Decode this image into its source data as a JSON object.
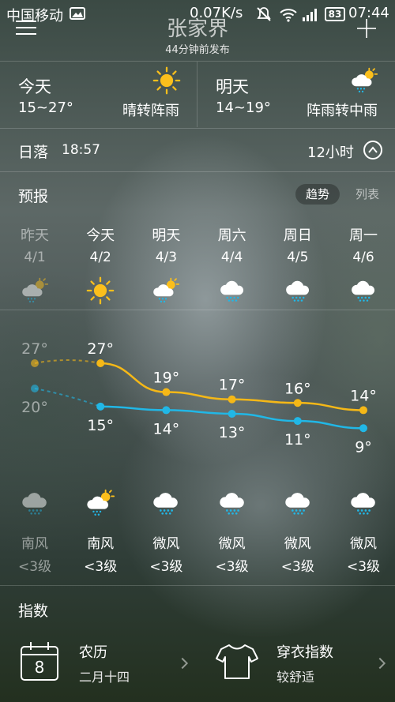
{
  "status_bar": {
    "carrier": "中国移动",
    "speed": "0.07K/s",
    "battery": "83",
    "time": "07:44"
  },
  "header": {
    "city": "张家界",
    "published": "44分钟前发布"
  },
  "today": {
    "label": "今天",
    "range": "15~27°",
    "condition": "晴转阵雨",
    "icon": "sun-icon"
  },
  "tomorrow": {
    "label": "明天",
    "range": "14~19°",
    "condition": "阵雨转中雨",
    "icon": "cloud-rain-sun-icon"
  },
  "sunset": {
    "label": "日落",
    "time": "18:57",
    "toggle_label": "12小时"
  },
  "forecast": {
    "title": "预报",
    "tab_trend": "趋势",
    "tab_list": "列表",
    "days": [
      {
        "name": "昨天",
        "date": "4/1",
        "day_icon": "cloud-sun-rain-icon",
        "high": 27,
        "low": 20,
        "night_icon": "cloud-rain-icon",
        "wind_dir": "南风",
        "wind_level": "<3级",
        "past": true
      },
      {
        "name": "今天",
        "date": "4/2",
        "day_icon": "sun-icon",
        "high": 27,
        "low": 15,
        "night_icon": "cloud-sun-rain-icon",
        "wind_dir": "南风",
        "wind_level": "<3级",
        "past": false
      },
      {
        "name": "明天",
        "date": "4/3",
        "day_icon": "cloud-sun-rain-icon",
        "high": 19,
        "low": 14,
        "night_icon": "cloud-rain-icon",
        "wind_dir": "微风",
        "wind_level": "<3级",
        "past": false
      },
      {
        "name": "周六",
        "date": "4/4",
        "day_icon": "cloud-rain-icon",
        "high": 17,
        "low": 13,
        "night_icon": "cloud-rain-icon",
        "wind_dir": "微风",
        "wind_level": "<3级",
        "past": false
      },
      {
        "name": "周日",
        "date": "4/5",
        "day_icon": "cloud-rain-icon",
        "high": 16,
        "low": 11,
        "night_icon": "cloud-rain-icon",
        "wind_dir": "微风",
        "wind_level": "<3级",
        "past": false
      },
      {
        "name": "周一",
        "date": "4/6",
        "day_icon": "cloud-rain-icon",
        "high": 14,
        "low": 9,
        "night_icon": "cloud-rain-icon",
        "wind_dir": "微风",
        "wind_level": "<3级",
        "past": false
      }
    ]
  },
  "chart_data": {
    "type": "line",
    "categories": [
      "4/1",
      "4/2",
      "4/3",
      "4/4",
      "4/5",
      "4/6"
    ],
    "series": [
      {
        "values": [
          27,
          27,
          19,
          17,
          16,
          14
        ],
        "color": "#f5b817"
      },
      {
        "values": [
          20,
          15,
          14,
          13,
          11,
          9
        ],
        "color": "#21b7e6"
      }
    ]
  },
  "indices": {
    "title": "指数",
    "items": [
      {
        "title": "农历",
        "value": "二月十四",
        "icon": "calendar-icon",
        "icon_text": "8"
      },
      {
        "title": "穿衣指数",
        "value": "较舒适",
        "icon": "tshirt-icon"
      }
    ]
  },
  "colors": {
    "high_line": "#f5b817",
    "low_line": "#21b7e6",
    "sun": "#fbbf1c"
  }
}
